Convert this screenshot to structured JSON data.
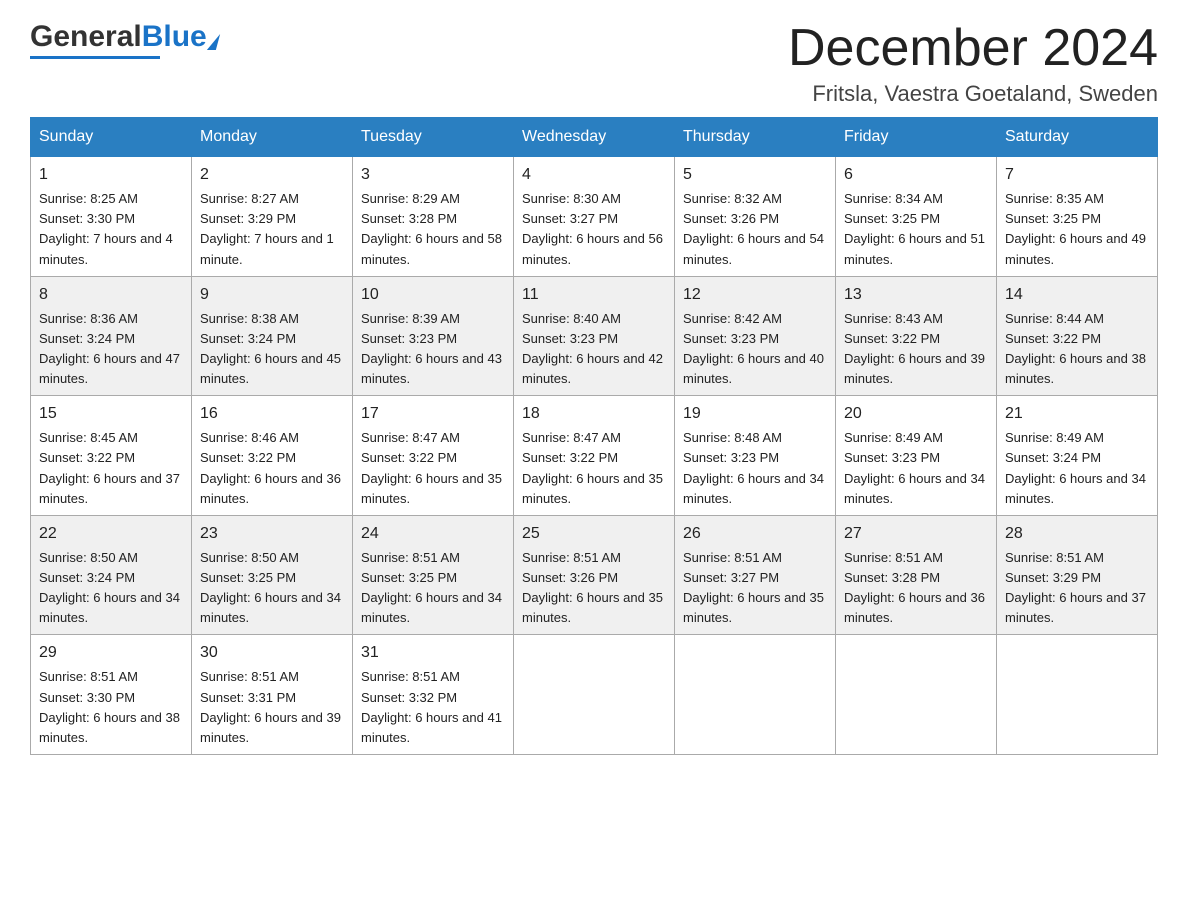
{
  "header": {
    "logo_general": "General",
    "logo_blue": "Blue",
    "month_title": "December 2024",
    "location": "Fritsla, Vaestra Goetaland, Sweden"
  },
  "days_of_week": [
    "Sunday",
    "Monday",
    "Tuesday",
    "Wednesday",
    "Thursday",
    "Friday",
    "Saturday"
  ],
  "weeks": [
    [
      {
        "day": "1",
        "sunrise": "8:25 AM",
        "sunset": "3:30 PM",
        "daylight": "7 hours and 4 minutes."
      },
      {
        "day": "2",
        "sunrise": "8:27 AM",
        "sunset": "3:29 PM",
        "daylight": "7 hours and 1 minute."
      },
      {
        "day": "3",
        "sunrise": "8:29 AM",
        "sunset": "3:28 PM",
        "daylight": "6 hours and 58 minutes."
      },
      {
        "day": "4",
        "sunrise": "8:30 AM",
        "sunset": "3:27 PM",
        "daylight": "6 hours and 56 minutes."
      },
      {
        "day": "5",
        "sunrise": "8:32 AM",
        "sunset": "3:26 PM",
        "daylight": "6 hours and 54 minutes."
      },
      {
        "day": "6",
        "sunrise": "8:34 AM",
        "sunset": "3:25 PM",
        "daylight": "6 hours and 51 minutes."
      },
      {
        "day": "7",
        "sunrise": "8:35 AM",
        "sunset": "3:25 PM",
        "daylight": "6 hours and 49 minutes."
      }
    ],
    [
      {
        "day": "8",
        "sunrise": "8:36 AM",
        "sunset": "3:24 PM",
        "daylight": "6 hours and 47 minutes."
      },
      {
        "day": "9",
        "sunrise": "8:38 AM",
        "sunset": "3:24 PM",
        "daylight": "6 hours and 45 minutes."
      },
      {
        "day": "10",
        "sunrise": "8:39 AM",
        "sunset": "3:23 PM",
        "daylight": "6 hours and 43 minutes."
      },
      {
        "day": "11",
        "sunrise": "8:40 AM",
        "sunset": "3:23 PM",
        "daylight": "6 hours and 42 minutes."
      },
      {
        "day": "12",
        "sunrise": "8:42 AM",
        "sunset": "3:23 PM",
        "daylight": "6 hours and 40 minutes."
      },
      {
        "day": "13",
        "sunrise": "8:43 AM",
        "sunset": "3:22 PM",
        "daylight": "6 hours and 39 minutes."
      },
      {
        "day": "14",
        "sunrise": "8:44 AM",
        "sunset": "3:22 PM",
        "daylight": "6 hours and 38 minutes."
      }
    ],
    [
      {
        "day": "15",
        "sunrise": "8:45 AM",
        "sunset": "3:22 PM",
        "daylight": "6 hours and 37 minutes."
      },
      {
        "day": "16",
        "sunrise": "8:46 AM",
        "sunset": "3:22 PM",
        "daylight": "6 hours and 36 minutes."
      },
      {
        "day": "17",
        "sunrise": "8:47 AM",
        "sunset": "3:22 PM",
        "daylight": "6 hours and 35 minutes."
      },
      {
        "day": "18",
        "sunrise": "8:47 AM",
        "sunset": "3:22 PM",
        "daylight": "6 hours and 35 minutes."
      },
      {
        "day": "19",
        "sunrise": "8:48 AM",
        "sunset": "3:23 PM",
        "daylight": "6 hours and 34 minutes."
      },
      {
        "day": "20",
        "sunrise": "8:49 AM",
        "sunset": "3:23 PM",
        "daylight": "6 hours and 34 minutes."
      },
      {
        "day": "21",
        "sunrise": "8:49 AM",
        "sunset": "3:24 PM",
        "daylight": "6 hours and 34 minutes."
      }
    ],
    [
      {
        "day": "22",
        "sunrise": "8:50 AM",
        "sunset": "3:24 PM",
        "daylight": "6 hours and 34 minutes."
      },
      {
        "day": "23",
        "sunrise": "8:50 AM",
        "sunset": "3:25 PM",
        "daylight": "6 hours and 34 minutes."
      },
      {
        "day": "24",
        "sunrise": "8:51 AM",
        "sunset": "3:25 PM",
        "daylight": "6 hours and 34 minutes."
      },
      {
        "day": "25",
        "sunrise": "8:51 AM",
        "sunset": "3:26 PM",
        "daylight": "6 hours and 35 minutes."
      },
      {
        "day": "26",
        "sunrise": "8:51 AM",
        "sunset": "3:27 PM",
        "daylight": "6 hours and 35 minutes."
      },
      {
        "day": "27",
        "sunrise": "8:51 AM",
        "sunset": "3:28 PM",
        "daylight": "6 hours and 36 minutes."
      },
      {
        "day": "28",
        "sunrise": "8:51 AM",
        "sunset": "3:29 PM",
        "daylight": "6 hours and 37 minutes."
      }
    ],
    [
      {
        "day": "29",
        "sunrise": "8:51 AM",
        "sunset": "3:30 PM",
        "daylight": "6 hours and 38 minutes."
      },
      {
        "day": "30",
        "sunrise": "8:51 AM",
        "sunset": "3:31 PM",
        "daylight": "6 hours and 39 minutes."
      },
      {
        "day": "31",
        "sunrise": "8:51 AM",
        "sunset": "3:32 PM",
        "daylight": "6 hours and 41 minutes."
      },
      null,
      null,
      null,
      null
    ]
  ],
  "labels": {
    "sunrise": "Sunrise:",
    "sunset": "Sunset:",
    "daylight": "Daylight:"
  }
}
